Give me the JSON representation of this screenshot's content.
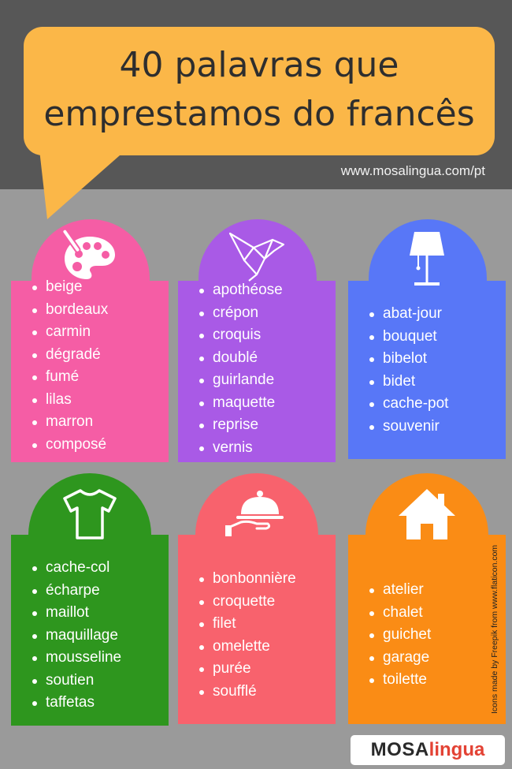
{
  "header": {
    "title_line1": "40 palavras que",
    "title_line2": "emprestamos do francês",
    "site_url": "www.mosalingua.com/pt"
  },
  "colors": {
    "header_band": "#575757",
    "background": "#9a9a9a",
    "bubble": "#fbb748",
    "pink": "#f55da5",
    "purple": "#a95ae6",
    "blue": "#5877f7",
    "green": "#2e961e",
    "coral": "#f8626d",
    "orange": "#fa8c15",
    "logo_red": "#e34234"
  },
  "cards": [
    {
      "icon": "palette-icon",
      "items": [
        "beige",
        "bordeaux",
        "carmin",
        "dégradé",
        "fumé",
        "lilas",
        "marron",
        "composé"
      ]
    },
    {
      "icon": "origami-bird-icon",
      "items": [
        "apothéose",
        "crépon",
        "croquis",
        "doublé",
        "guirlande",
        "maquette",
        "reprise",
        "vernis"
      ]
    },
    {
      "icon": "lamp-icon",
      "items": [
        "abat-jour",
        "bouquet",
        "bibelot",
        "bidet",
        "cache-pot",
        "souvenir"
      ]
    },
    {
      "icon": "tshirt-icon",
      "items": [
        "cache-col",
        "écharpe",
        "maillot",
        "maquillage",
        "mousseline",
        "soutien",
        "taffetas"
      ]
    },
    {
      "icon": "cloche-tray-icon",
      "items": [
        "bonbonnière",
        "croquette",
        "filet",
        "omelette",
        "purée",
        "soufflé"
      ]
    },
    {
      "icon": "house-icon",
      "items": [
        "atelier",
        "chalet",
        "guichet",
        "garage",
        "toilette"
      ]
    }
  ],
  "credit": "Icons made by Freepik from www.flaticon.com",
  "logo": {
    "part1": "MOSA",
    "part2": "lingua"
  }
}
